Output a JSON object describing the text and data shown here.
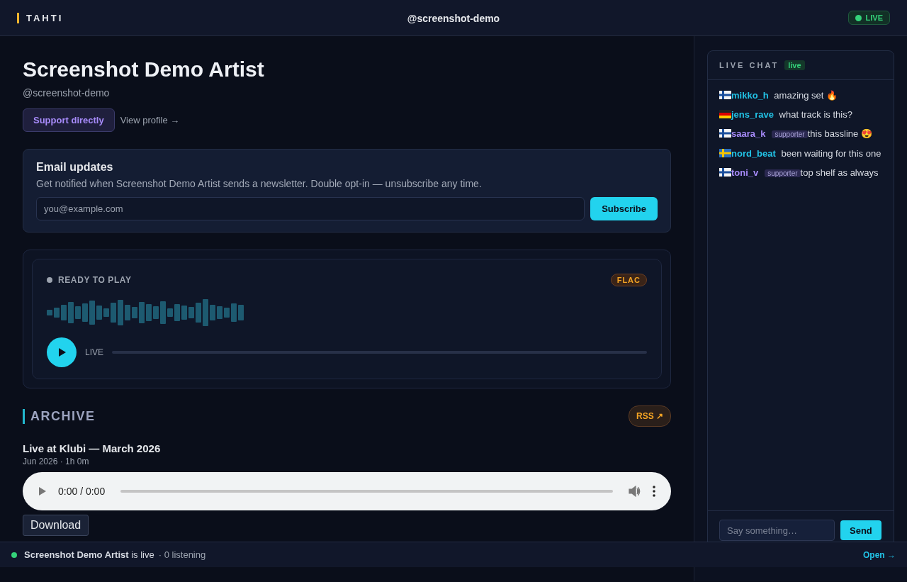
{
  "header": {
    "brand": "TAHTI",
    "handle": "@screenshot-demo",
    "live_badge": "LIVE"
  },
  "artist": {
    "name": "Screenshot Demo Artist",
    "handle": "@screenshot-demo",
    "support_button": "Support directly",
    "profile_link": "View profile →"
  },
  "email": {
    "title": "Email updates",
    "description": "Get notified when Screenshot Demo Artist sends a newsletter. Double opt-in — unsubscribe any time.",
    "placeholder": "you@example.com",
    "button": "Subscribe"
  },
  "player": {
    "status": "READY TO PLAY",
    "format": "FLAC",
    "live_label": "LIVE"
  },
  "archive": {
    "title": "ARCHIVE",
    "rss": "RSS ↗",
    "items": [
      {
        "title": "Live at Klubi — March 2026",
        "meta": "Jun 2026 · 1h 0m",
        "time": "0:00 / 0:00",
        "download": "Download"
      }
    ]
  },
  "chat": {
    "title": "LIVE CHAT",
    "badge": "live",
    "placeholder": "Say something…",
    "send": "Send",
    "messages": [
      {
        "kind": "fi",
        "user": "mikko_h",
        "text": "amazing set 🔥"
      },
      {
        "kind": "de",
        "user": "jens_rave",
        "text": "what track is this?"
      },
      {
        "kind": "fi",
        "user": "saara_k",
        "badge": "supporter",
        "text": "this bassline 😍"
      },
      {
        "kind": "se",
        "user": "nord_beat",
        "text": "been waiting for this one"
      },
      {
        "kind": "fi",
        "user": "toni_v",
        "badge": "supporter",
        "text": "top shelf as always"
      }
    ]
  },
  "footer": {
    "text": "**Screenshot Demo Artist** is live",
    "listeners": "· 0 listening",
    "open": "Open →"
  }
}
